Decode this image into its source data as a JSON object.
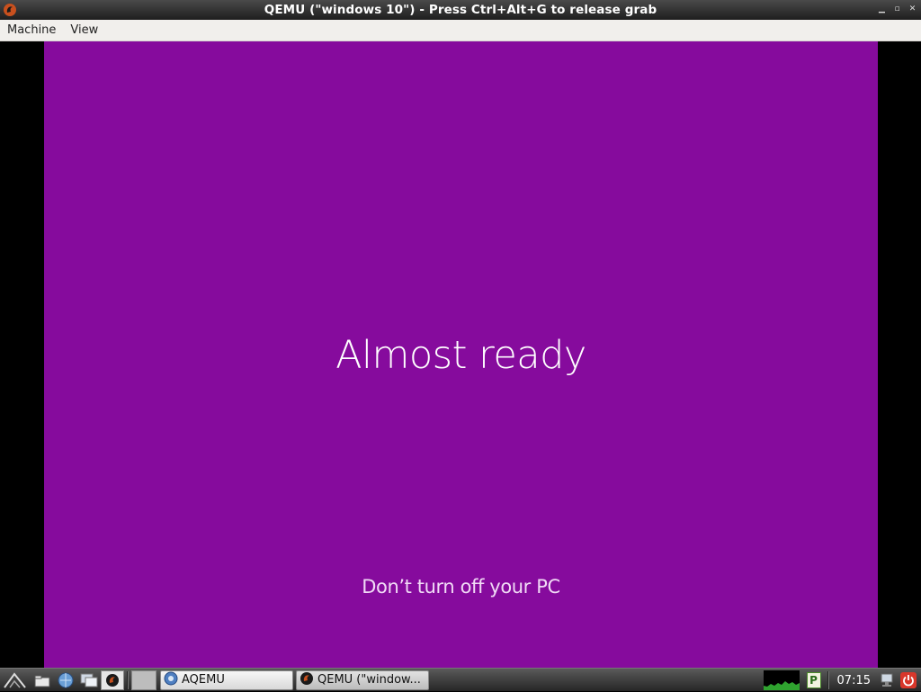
{
  "window": {
    "title": "QEMU (\"windows 10\") - Press Ctrl+Alt+G to release grab",
    "controls": [
      "minimize",
      "maximize",
      "close"
    ]
  },
  "menubar": {
    "items": [
      "Machine",
      "View"
    ]
  },
  "guest": {
    "background_color": "#860b9d",
    "message": "Almost ready",
    "submessage": "Don’t turn off your PC"
  },
  "taskbar": {
    "launchers": [
      "menu-icon",
      "files-icon",
      "browser-icon",
      "desktop-icon",
      "qemu-icon"
    ],
    "tasks": [
      {
        "label": "AQEMU",
        "icon": "aqemu-icon"
      },
      {
        "label": "QEMU (\"window...",
        "icon": "qemu-icon"
      }
    ],
    "tray": {
      "clock": "07:15",
      "pager_label": "P"
    }
  }
}
